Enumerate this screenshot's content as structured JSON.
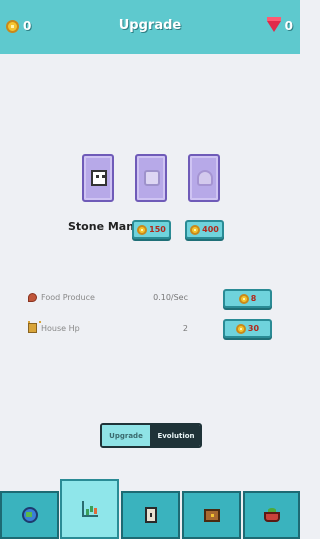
{
  "header": {
    "coins": "0",
    "title": "Upgrade",
    "gems": "0"
  },
  "hero": {
    "name": "Stone Man",
    "evolution_costs": [
      "150",
      "400"
    ]
  },
  "stats": [
    {
      "label": "Food Produce",
      "value": "0.10/Sec",
      "cost": "8",
      "icon": "meat-icon"
    },
    {
      "label": "House Hp",
      "value": "2",
      "cost": "30",
      "icon": "tower-icon"
    }
  ],
  "tabs": {
    "upgrade": "Upgrade",
    "evolution": "Evolution",
    "active": "upgrade"
  },
  "bottom_nav": {
    "icons": [
      "globe-icon",
      "chart-icon",
      "tower-icon",
      "chest-icon",
      "basket-icon"
    ],
    "active_index": 1
  },
  "colors": {
    "header": "#5ec9ce",
    "button": "#6fd3dc",
    "card": "#b7a9e8",
    "cost_text": "#b3281c"
  }
}
